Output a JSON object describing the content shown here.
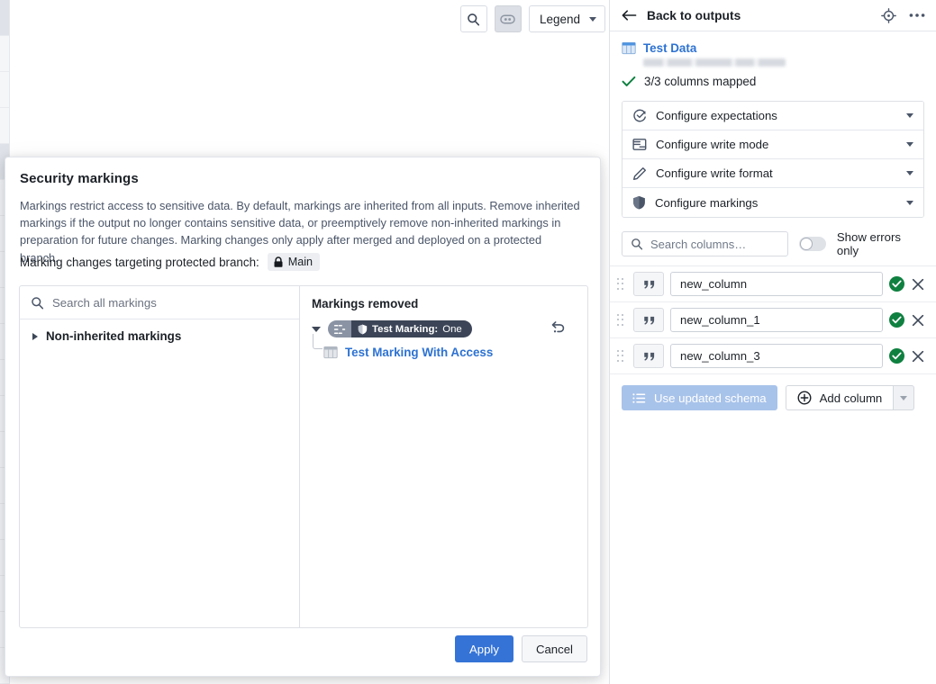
{
  "toolbar": {
    "search_icon": "search-icon",
    "details_icon": "node-details-icon",
    "legend_label": "Legend"
  },
  "dialog": {
    "title": "Security markings",
    "description": "Markings restrict access to sensitive data. By default, markings are inherited from all inputs. Remove inherited markings if the output no longer contains sensitive data, or preemptively remove non-inherited markings in preparation for future changes. Marking changes only apply after merged and deployed on a protected branch.",
    "branch_label": "Marking changes targeting protected branch:",
    "branch_name": "Main",
    "branch_icon": "lock-icon",
    "left_pane": {
      "search_placeholder": "Search all markings",
      "search_icon": "search-icon",
      "group_label": "Non-inherited markings",
      "group_expanded": false
    },
    "right_pane": {
      "title": "Markings removed",
      "items": [
        {
          "expanded": true,
          "badge_icon": "marking-hierarchy-icon",
          "shield_icon": "shield-icon",
          "marking_key": "Test Marking:",
          "marking_value": "One",
          "undo_icon": "undo-icon",
          "child": {
            "icon": "table-icon",
            "label": "Test Marking With Access"
          }
        }
      ]
    },
    "apply_label": "Apply",
    "cancel_label": "Cancel"
  },
  "right_panel": {
    "back_label": "Back to outputs",
    "back_icon": "arrow-left-icon",
    "target_icon": "target-icon",
    "more_icon": "more-horizontal-icon",
    "dataset": {
      "icon": "table-icon",
      "name": "Test Data",
      "path": "",
      "mapped_status": "3/3 columns mapped",
      "mapped_icon": "check-icon"
    },
    "config_rows": [
      {
        "icon": "expectations-icon",
        "label": "Configure expectations"
      },
      {
        "icon": "write-mode-icon",
        "label": "Configure write mode"
      },
      {
        "icon": "pencil-icon",
        "label": "Configure write format"
      },
      {
        "icon": "shield-icon",
        "label": "Configure markings"
      }
    ],
    "columns_search_placeholder": "Search columns…",
    "columns_search_icon": "search-icon",
    "errors_toggle_label": "Show errors only",
    "errors_toggle_on": false,
    "columns": [
      {
        "type_icon": "string-type-icon",
        "name": "new_column",
        "status": "valid",
        "remove_icon": "close-icon"
      },
      {
        "type_icon": "string-type-icon",
        "name": "new_column_1",
        "status": "valid",
        "remove_icon": "close-icon"
      },
      {
        "type_icon": "string-type-icon",
        "name": "new_column_3",
        "status": "valid",
        "remove_icon": "close-icon"
      }
    ],
    "use_schema_label": "Use updated schema",
    "use_schema_icon": "list-icon",
    "add_column_label": "Add column",
    "add_column_icon": "plus-circle-icon"
  },
  "colors": {
    "accent_blue": "#3573d6",
    "link_blue": "#2d72d2",
    "success_green": "#0f8040",
    "pill_dark": "#3c4557",
    "disabled_blue": "#a8c3ea"
  }
}
